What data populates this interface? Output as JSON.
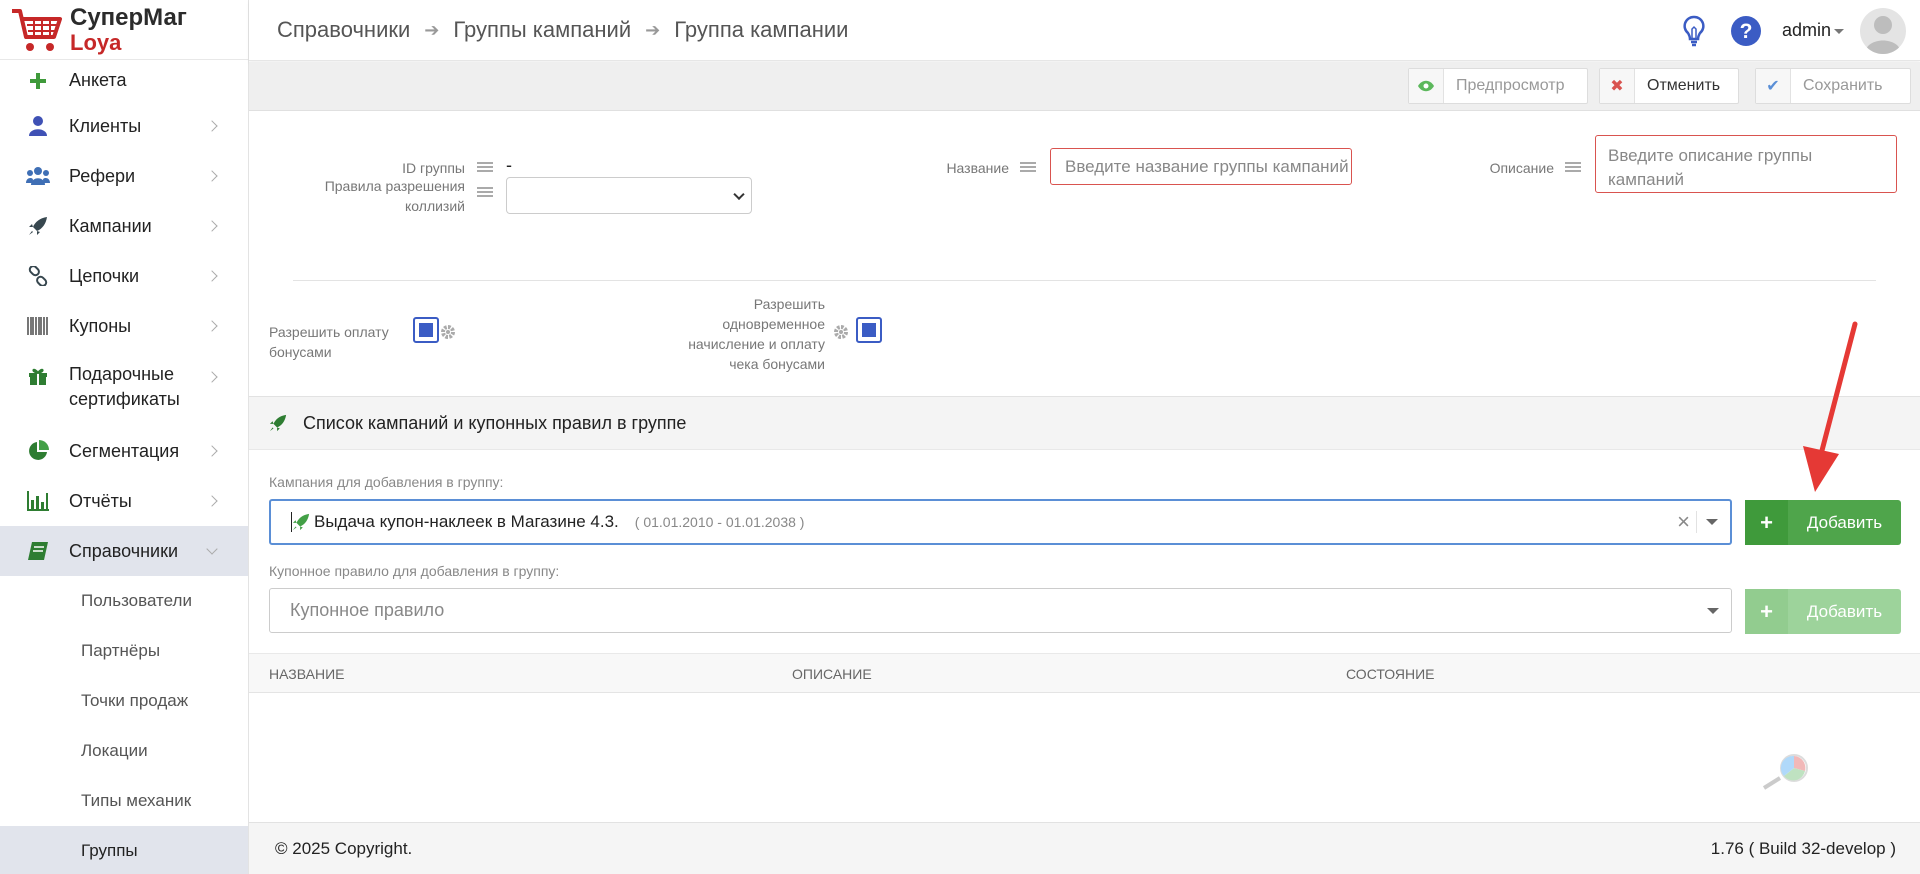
{
  "logo": {
    "line1": "СуперМаг",
    "line2": "Loya"
  },
  "sidebar": {
    "items": [
      {
        "label": "Анкета",
        "icon": "plus-icon"
      },
      {
        "label": "Клиенты",
        "icon": "user-icon"
      },
      {
        "label": "Рефери",
        "icon": "users-icon"
      },
      {
        "label": "Кампании",
        "icon": "rocket-icon"
      },
      {
        "label": "Цепочки",
        "icon": "link-icon"
      },
      {
        "label": "Купоны",
        "icon": "barcode-icon"
      },
      {
        "label": "Подарочные сертификаты",
        "icon": "gift-icon"
      },
      {
        "label": "Сегментация",
        "icon": "pie-chart-icon"
      },
      {
        "label": "Отчёты",
        "icon": "bar-chart-icon"
      },
      {
        "label": "Справочники",
        "icon": "book-icon"
      }
    ],
    "subitems": [
      {
        "label": "Пользователи"
      },
      {
        "label": "Партнёры"
      },
      {
        "label": "Точки продаж"
      },
      {
        "label": "Локации"
      },
      {
        "label": "Типы механик"
      },
      {
        "label": "Группы"
      }
    ]
  },
  "header": {
    "breadcrumbs": [
      "Справочники",
      "Группы кампаний",
      "Группа кампании"
    ],
    "user": "admin"
  },
  "toolbar": {
    "preview_label": "Предпросмотр",
    "cancel_label": "Отменить",
    "save_label": "Сохранить"
  },
  "form": {
    "group_id_label": "ID группы",
    "group_id_value": "-",
    "name_label": "Название",
    "name_placeholder": "Введите название группы кампаний",
    "description_label": "Описание",
    "description_placeholder": "Введите описание группы кампаний",
    "collision_label": "Правила разрешения коллизий",
    "collision_value": "",
    "allow_bonus_label": "Разрешить оплату бонусами",
    "allow_bonus_checked": true,
    "allow_simultaneous_label": "Разрешить одновременное начисление и оплату чека бонусами",
    "allow_simultaneous_checked": true
  },
  "campaigns": {
    "title": "Список кампаний и купонных правил в группе",
    "campaign_label": "Кампания для добавления в группу:",
    "campaign_value": "Выдача купон-наклеек в Магазине 4.3.",
    "campaign_dates": "( 01.01.2010 - 01.01.2038 )",
    "add_label": "Добавить",
    "coupon_label": "Купонное правило для добавления в группу:",
    "coupon_placeholder": "Купонное правило",
    "add_coupon_label": "Добавить",
    "columns": [
      "НАЗВАНИЕ",
      "ОПИСАНИЕ",
      "СОСТОЯНИЕ"
    ]
  },
  "footer": {
    "copyright": "© 2025 Copyright.",
    "version": "1.76 ( Build 32-develop )"
  },
  "colors": {
    "accent": "#3b5cc4",
    "success": "#4fa54b",
    "danger": "#d9534f",
    "annotation_arrow": "#e53935"
  }
}
